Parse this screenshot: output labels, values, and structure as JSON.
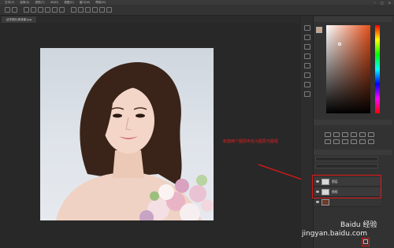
{
  "menubar": {
    "items": [
      "文字(Y)",
      "选择(S)",
      "滤镜(T)",
      "3D(D)",
      "视图(V)",
      "窗口(W)",
      "帮助(H)"
    ]
  },
  "doc": {
    "tab_title": "证件照片换背景.jpg"
  },
  "annotation": {
    "text": "新建两个图层命名为图层与图框"
  },
  "layers": {
    "rows": [
      {
        "label": "图层"
      },
      {
        "label": "图框"
      }
    ]
  },
  "watermark": {
    "brand": "Baidu 经验",
    "url": "jingyan.baidu.com"
  },
  "colors": {
    "annotation": "#e02020",
    "highlight": "#e01818"
  },
  "icons": [
    "eye-icon",
    "layer-thumbnail-icon",
    "new-layer-icon",
    "arrow-icon"
  ]
}
